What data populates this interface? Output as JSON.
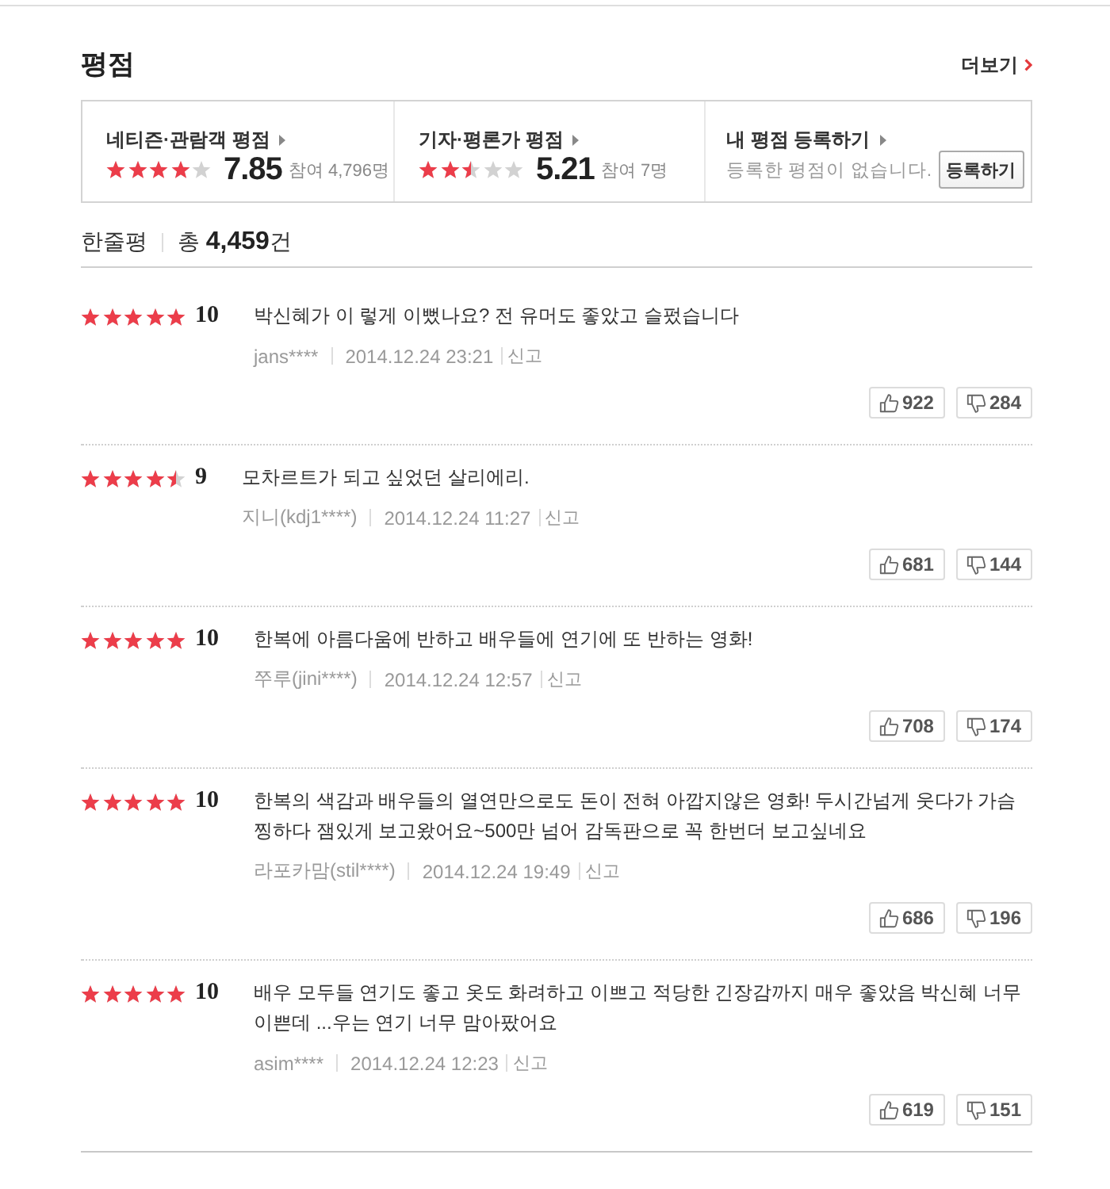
{
  "header": {
    "title": "평점",
    "more_link": "더보기"
  },
  "rating_summary": [
    {
      "kind": "score",
      "label": "네티즌·관람객 평점",
      "stars": 4,
      "score": "7.85",
      "participants": "참여 4,796명"
    },
    {
      "kind": "score",
      "label": "기자·평론가 평점",
      "stars": 2.5,
      "score": "5.21",
      "participants": "참여 7명"
    },
    {
      "kind": "register",
      "label": "내 평점 등록하기",
      "message": "등록한 평점이 없습니다.",
      "button": "등록하기"
    }
  ],
  "reviews_header": {
    "title": "한줄평",
    "total": "총 **4,459**건"
  },
  "reviews": [
    {
      "stars": 5,
      "score": "10",
      "text": "박신혜가 이 렇게 이뻤나요? 전 유머도 좋았고 슬펐습니다",
      "author": "jans****",
      "date": "2014.12.24 23:21",
      "report": "신고",
      "likes": "922",
      "dislikes": "284"
    },
    {
      "stars": 4.5,
      "score": "9",
      "text": "모차르트가 되고 싶었던 살리에리.",
      "author": "지니(kdj1****)",
      "date": "2014.12.24 11:27",
      "report": "신고",
      "likes": "681",
      "dislikes": "144"
    },
    {
      "stars": 5,
      "score": "10",
      "text": "한복에 아름다움에 반하고 배우들에 연기에 또 반하는 영화!",
      "author": "쭈루(jini****)",
      "date": "2014.12.24 12:57",
      "report": "신고",
      "likes": "708",
      "dislikes": "174"
    },
    {
      "stars": 5,
      "score": "10",
      "text": "한복의 색감과 배우들의 열연만으로도 돈이 전혀 아깝지않은 영화! 두시간넘게 웃다가 가슴 찡하다 잼있게 보고왔어요~500만 넘어 감독판으로 꼭 한번더 보고싶네요",
      "author": "라포카맘(stil****)",
      "date": "2014.12.24 19:49",
      "report": "신고",
      "likes": "686",
      "dislikes": "196"
    },
    {
      "stars": 5,
      "score": "10",
      "text": "배우 모두들 연기도 좋고 옷도 화려하고 이쁘고 적당한 긴장감까지 매우 좋았음 박신혜 너무 이쁜데 ...우는 연기 너무 맘아팠어요",
      "author": "asim****",
      "date": "2014.12.24 12:23",
      "report": "신고",
      "likes": "619",
      "dislikes": "151"
    }
  ]
}
